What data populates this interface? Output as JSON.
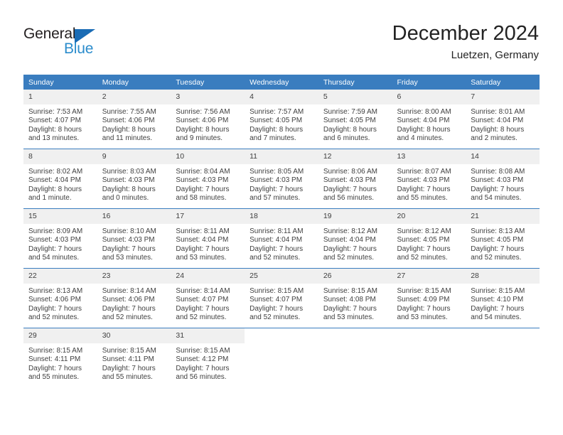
{
  "brand": {
    "name_part1": "General",
    "name_part2": "Blue",
    "triangle_color": "#1a6cb5",
    "blue_color": "#2b8ccc"
  },
  "header": {
    "title": "December 2024",
    "location": "Luetzen, Germany"
  },
  "theme": {
    "header_blue": "#3a7dbf",
    "daynum_gray": "#f0f0f0",
    "text_color": "#404040"
  },
  "calendar": {
    "weekdays": [
      "Sunday",
      "Monday",
      "Tuesday",
      "Wednesday",
      "Thursday",
      "Friday",
      "Saturday"
    ],
    "weeks": [
      [
        {
          "day": "1",
          "sunrise": "Sunrise: 7:53 AM",
          "sunset": "Sunset: 4:07 PM",
          "daylight1": "Daylight: 8 hours",
          "daylight2": "and 13 minutes."
        },
        {
          "day": "2",
          "sunrise": "Sunrise: 7:55 AM",
          "sunset": "Sunset: 4:06 PM",
          "daylight1": "Daylight: 8 hours",
          "daylight2": "and 11 minutes."
        },
        {
          "day": "3",
          "sunrise": "Sunrise: 7:56 AM",
          "sunset": "Sunset: 4:06 PM",
          "daylight1": "Daylight: 8 hours",
          "daylight2": "and 9 minutes."
        },
        {
          "day": "4",
          "sunrise": "Sunrise: 7:57 AM",
          "sunset": "Sunset: 4:05 PM",
          "daylight1": "Daylight: 8 hours",
          "daylight2": "and 7 minutes."
        },
        {
          "day": "5",
          "sunrise": "Sunrise: 7:59 AM",
          "sunset": "Sunset: 4:05 PM",
          "daylight1": "Daylight: 8 hours",
          "daylight2": "and 6 minutes."
        },
        {
          "day": "6",
          "sunrise": "Sunrise: 8:00 AM",
          "sunset": "Sunset: 4:04 PM",
          "daylight1": "Daylight: 8 hours",
          "daylight2": "and 4 minutes."
        },
        {
          "day": "7",
          "sunrise": "Sunrise: 8:01 AM",
          "sunset": "Sunset: 4:04 PM",
          "daylight1": "Daylight: 8 hours",
          "daylight2": "and 2 minutes."
        }
      ],
      [
        {
          "day": "8",
          "sunrise": "Sunrise: 8:02 AM",
          "sunset": "Sunset: 4:04 PM",
          "daylight1": "Daylight: 8 hours",
          "daylight2": "and 1 minute."
        },
        {
          "day": "9",
          "sunrise": "Sunrise: 8:03 AM",
          "sunset": "Sunset: 4:03 PM",
          "daylight1": "Daylight: 8 hours",
          "daylight2": "and 0 minutes."
        },
        {
          "day": "10",
          "sunrise": "Sunrise: 8:04 AM",
          "sunset": "Sunset: 4:03 PM",
          "daylight1": "Daylight: 7 hours",
          "daylight2": "and 58 minutes."
        },
        {
          "day": "11",
          "sunrise": "Sunrise: 8:05 AM",
          "sunset": "Sunset: 4:03 PM",
          "daylight1": "Daylight: 7 hours",
          "daylight2": "and 57 minutes."
        },
        {
          "day": "12",
          "sunrise": "Sunrise: 8:06 AM",
          "sunset": "Sunset: 4:03 PM",
          "daylight1": "Daylight: 7 hours",
          "daylight2": "and 56 minutes."
        },
        {
          "day": "13",
          "sunrise": "Sunrise: 8:07 AM",
          "sunset": "Sunset: 4:03 PM",
          "daylight1": "Daylight: 7 hours",
          "daylight2": "and 55 minutes."
        },
        {
          "day": "14",
          "sunrise": "Sunrise: 8:08 AM",
          "sunset": "Sunset: 4:03 PM",
          "daylight1": "Daylight: 7 hours",
          "daylight2": "and 54 minutes."
        }
      ],
      [
        {
          "day": "15",
          "sunrise": "Sunrise: 8:09 AM",
          "sunset": "Sunset: 4:03 PM",
          "daylight1": "Daylight: 7 hours",
          "daylight2": "and 54 minutes."
        },
        {
          "day": "16",
          "sunrise": "Sunrise: 8:10 AM",
          "sunset": "Sunset: 4:03 PM",
          "daylight1": "Daylight: 7 hours",
          "daylight2": "and 53 minutes."
        },
        {
          "day": "17",
          "sunrise": "Sunrise: 8:11 AM",
          "sunset": "Sunset: 4:04 PM",
          "daylight1": "Daylight: 7 hours",
          "daylight2": "and 53 minutes."
        },
        {
          "day": "18",
          "sunrise": "Sunrise: 8:11 AM",
          "sunset": "Sunset: 4:04 PM",
          "daylight1": "Daylight: 7 hours",
          "daylight2": "and 52 minutes."
        },
        {
          "day": "19",
          "sunrise": "Sunrise: 8:12 AM",
          "sunset": "Sunset: 4:04 PM",
          "daylight1": "Daylight: 7 hours",
          "daylight2": "and 52 minutes."
        },
        {
          "day": "20",
          "sunrise": "Sunrise: 8:12 AM",
          "sunset": "Sunset: 4:05 PM",
          "daylight1": "Daylight: 7 hours",
          "daylight2": "and 52 minutes."
        },
        {
          "day": "21",
          "sunrise": "Sunrise: 8:13 AM",
          "sunset": "Sunset: 4:05 PM",
          "daylight1": "Daylight: 7 hours",
          "daylight2": "and 52 minutes."
        }
      ],
      [
        {
          "day": "22",
          "sunrise": "Sunrise: 8:13 AM",
          "sunset": "Sunset: 4:06 PM",
          "daylight1": "Daylight: 7 hours",
          "daylight2": "and 52 minutes."
        },
        {
          "day": "23",
          "sunrise": "Sunrise: 8:14 AM",
          "sunset": "Sunset: 4:06 PM",
          "daylight1": "Daylight: 7 hours",
          "daylight2": "and 52 minutes."
        },
        {
          "day": "24",
          "sunrise": "Sunrise: 8:14 AM",
          "sunset": "Sunset: 4:07 PM",
          "daylight1": "Daylight: 7 hours",
          "daylight2": "and 52 minutes."
        },
        {
          "day": "25",
          "sunrise": "Sunrise: 8:15 AM",
          "sunset": "Sunset: 4:07 PM",
          "daylight1": "Daylight: 7 hours",
          "daylight2": "and 52 minutes."
        },
        {
          "day": "26",
          "sunrise": "Sunrise: 8:15 AM",
          "sunset": "Sunset: 4:08 PM",
          "daylight1": "Daylight: 7 hours",
          "daylight2": "and 53 minutes."
        },
        {
          "day": "27",
          "sunrise": "Sunrise: 8:15 AM",
          "sunset": "Sunset: 4:09 PM",
          "daylight1": "Daylight: 7 hours",
          "daylight2": "and 53 minutes."
        },
        {
          "day": "28",
          "sunrise": "Sunrise: 8:15 AM",
          "sunset": "Sunset: 4:10 PM",
          "daylight1": "Daylight: 7 hours",
          "daylight2": "and 54 minutes."
        }
      ],
      [
        {
          "day": "29",
          "sunrise": "Sunrise: 8:15 AM",
          "sunset": "Sunset: 4:11 PM",
          "daylight1": "Daylight: 7 hours",
          "daylight2": "and 55 minutes."
        },
        {
          "day": "30",
          "sunrise": "Sunrise: 8:15 AM",
          "sunset": "Sunset: 4:11 PM",
          "daylight1": "Daylight: 7 hours",
          "daylight2": "and 55 minutes."
        },
        {
          "day": "31",
          "sunrise": "Sunrise: 8:15 AM",
          "sunset": "Sunset: 4:12 PM",
          "daylight1": "Daylight: 7 hours",
          "daylight2": "and 56 minutes."
        },
        {
          "day": "",
          "sunrise": "",
          "sunset": "",
          "daylight1": "",
          "daylight2": ""
        },
        {
          "day": "",
          "sunrise": "",
          "sunset": "",
          "daylight1": "",
          "daylight2": ""
        },
        {
          "day": "",
          "sunrise": "",
          "sunset": "",
          "daylight1": "",
          "daylight2": ""
        },
        {
          "day": "",
          "sunrise": "",
          "sunset": "",
          "daylight1": "",
          "daylight2": ""
        }
      ]
    ]
  }
}
